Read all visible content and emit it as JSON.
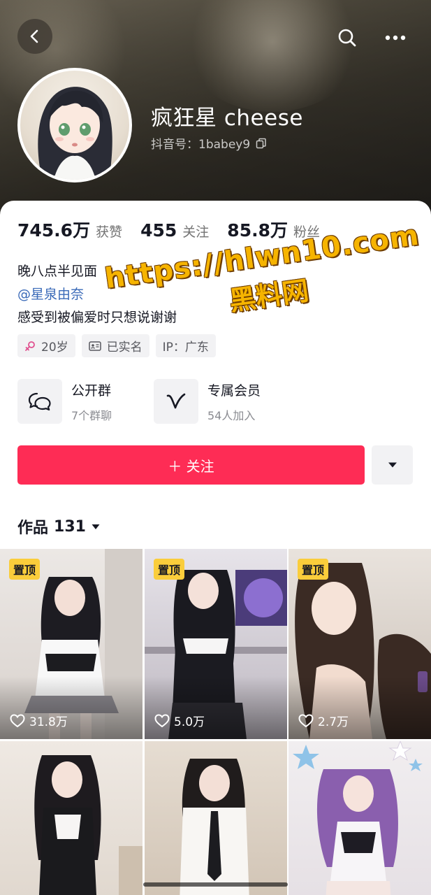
{
  "header": {
    "nickname": "疯狂星 cheese",
    "douyin_id": "抖音号：1babey9"
  },
  "icons": {
    "back": "chevron-left-icon",
    "search": "search-icon",
    "more": "more-horizontal-icon",
    "copy": "copy-icon"
  },
  "stats": [
    {
      "value": "745.6万",
      "label": "获赞"
    },
    {
      "value": "455",
      "label": "关注"
    },
    {
      "value": "85.8万",
      "label": "粉丝"
    }
  ],
  "bio": {
    "line1": "晚八点半见面",
    "mention": "@星泉由奈",
    "line3": "感受到被偏爱时只想说谢谢"
  },
  "tags": [
    {
      "label": "20岁",
      "icon": "female-icon"
    },
    {
      "label": "已实名",
      "icon": "id-card-icon"
    },
    {
      "label": "IP：广东",
      "icon": ""
    }
  ],
  "features": [
    {
      "title": "公开群",
      "subtitle": "7个群聊",
      "icon": "chat-bubbles-icon"
    },
    {
      "title": "专属会员",
      "subtitle": "54人加入",
      "icon": "vip-v-icon"
    }
  ],
  "follow_button": "＋ 关注",
  "works": {
    "label": "作品",
    "count": "131"
  },
  "grid": [
    {
      "pinned": "置顶",
      "likes": "31.8万"
    },
    {
      "pinned": "置顶",
      "likes": "5.0万"
    },
    {
      "pinned": "置顶",
      "likes": "2.7万"
    },
    {
      "pinned": "",
      "likes": ""
    },
    {
      "pinned": "",
      "likes": ""
    },
    {
      "pinned": "",
      "likes": ""
    }
  ],
  "watermark": {
    "line1": "https://hlwn10.com",
    "line2": "黑料网"
  },
  "colors": {
    "follow": "#fe2c55",
    "mention": "#3a6ab8",
    "pin": "#facd3b"
  }
}
